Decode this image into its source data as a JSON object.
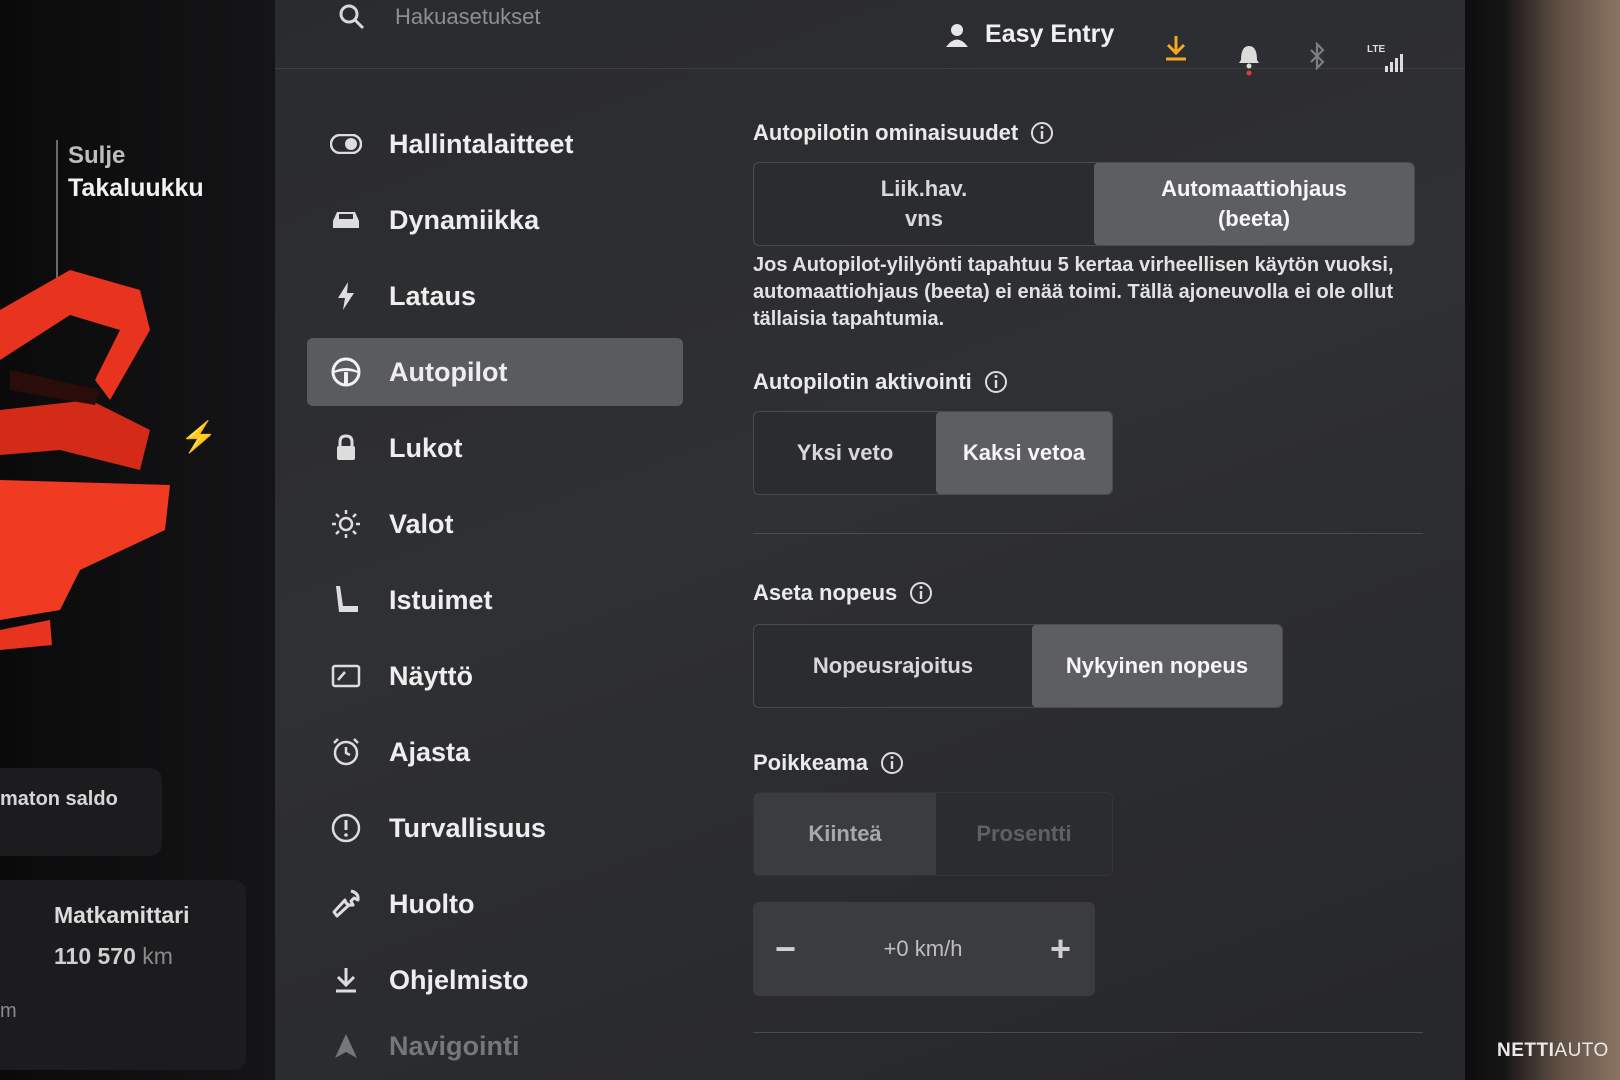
{
  "left_panel": {
    "close_label_1": "Sulje",
    "close_label_2": "Takaluukku",
    "balance_label": "maton saldo",
    "odometer_title": "Matkamittari",
    "odometer_value": "110 570",
    "odometer_unit": "km",
    "fragment_unit": "m"
  },
  "topbar": {
    "search_placeholder": "Hakuasetukset",
    "profile_name": "Easy Entry",
    "lte_label": "LTE"
  },
  "sidebar": {
    "items": [
      {
        "label": "Hallintalaitteet",
        "icon": "toggle-icon"
      },
      {
        "label": "Dynamiikka",
        "icon": "car-icon"
      },
      {
        "label": "Lataus",
        "icon": "bolt-icon"
      },
      {
        "label": "Autopilot",
        "icon": "steering-wheel-icon",
        "active": true
      },
      {
        "label": "Lukot",
        "icon": "lock-icon"
      },
      {
        "label": "Valot",
        "icon": "sun-icon"
      },
      {
        "label": "Istuimet",
        "icon": "seat-icon"
      },
      {
        "label": "Näyttö",
        "icon": "display-icon"
      },
      {
        "label": "Ajasta",
        "icon": "alarm-clock-icon"
      },
      {
        "label": "Turvallisuus",
        "icon": "alert-circle-icon"
      },
      {
        "label": "Huolto",
        "icon": "wrench-icon"
      },
      {
        "label": "Ohjelmisto",
        "icon": "download-icon"
      },
      {
        "label": "Navigointi",
        "icon": "navigation-icon"
      }
    ]
  },
  "autopilot": {
    "features": {
      "title": "Autopilotin ominaisuudet",
      "option_1_line_1": "Liik.hav.",
      "option_1_line_2": "vns",
      "option_2_line_1": "Automaattiohjaus",
      "option_2_line_2": "(beeta)",
      "selected": "Automaattiohjaus (beeta)"
    },
    "warning": "Jos Autopilot-ylilyönti tapahtuu 5 kertaa virheellisen käytön vuoksi, automaattiohjaus (beeta) ei enää toimi. Tällä ajoneuvolla ei ole ollut tällaisia tapahtumia.",
    "activation": {
      "title": "Autopilotin aktivointi",
      "options": [
        "Yksi veto",
        "Kaksi vetoa"
      ],
      "selected": "Kaksi vetoa"
    },
    "set_speed": {
      "title": "Aseta nopeus",
      "options": [
        "Nopeusrajoitus",
        "Nykyinen nopeus"
      ],
      "selected": "Nykyinen nopeus"
    },
    "offset": {
      "title": "Poikkeama",
      "options": [
        "Kiinteä",
        "Prosentti"
      ],
      "selected": "Kiinteä",
      "value": "+0 km/h",
      "minus": "−",
      "plus": "+"
    }
  },
  "watermark": {
    "part_1": "NETTI",
    "part_2": "AUTO"
  },
  "colors": {
    "accent_download": "#f5a623",
    "bell_dot": "#e53935",
    "car_red": "#e8331f"
  }
}
